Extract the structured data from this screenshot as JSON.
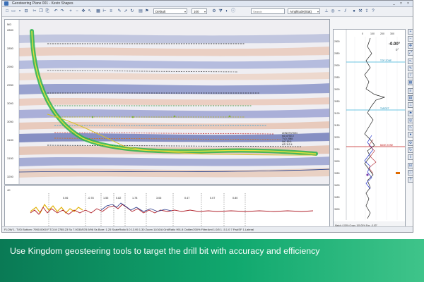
{
  "window": {
    "title": "Geosteering Plane 001 - Kevin Shapes",
    "min": "_",
    "max": "□",
    "close": "×"
  },
  "toolbar": {
    "display_select": "Default",
    "scale_select": "100",
    "attribute_select": "Amplitude(Stat)",
    "search_placeholder": "Search"
  },
  "seismic": {
    "depth_ticks": [
      "2800",
      "2850",
      "2900",
      "2950",
      "3000",
      "3050",
      "3100",
      "3150",
      "3200"
    ],
    "header_labels": [
      "MD",
      "TVD"
    ],
    "annotation_lines": [
      "ANNOTATION",
      "MD 8750.0",
      "TVD 2985",
      "INC 89.6",
      "AZI 112.4"
    ]
  },
  "bottom": {
    "segment_labels": [
      "0.06",
      "-0.78",
      "1.55",
      "0.82",
      "1.78",
      "3.06",
      "0.47",
      "0.07",
      "0.80"
    ],
    "left_tick": "40"
  },
  "log": {
    "depth_ticks": [
      "2800",
      "2850",
      "2900",
      "2950",
      "3000",
      "3050",
      "3100",
      "3150",
      "3200",
      "3250",
      "3300",
      "3350",
      "3400",
      "3450",
      "3500"
    ],
    "scale_top": [
      "0",
      "100",
      "200",
      "300"
    ],
    "value_big": "-0.00°",
    "value_small": "0°",
    "marker_labels": [
      "TOP ZONE",
      "TARGET",
      "BASE ZONE"
    ],
    "footer": "Match: 0.00%  Cross: 100.00%  Exp: -0.00°"
  },
  "status": {
    "text": "FLOW 1.  TVD Bottom: 7950.0000  F.T.D.M 2785.23 Ss  7.0030/578.9/96 Ss   Bore: 1.25  ScaleRatio 5.0   13.95  1.30 Zoom 11/16/A  GridRatio 991.8  Outlier/200%  FilterAmt 1.0/5 1 -5.1.0  7 FwdSF  1.Lateral",
    "log_footer": "7.00 1.1/88"
  },
  "banner": {
    "text": "Use Kingdom geosteering tools to target the drill bit with accuracy and efficiency"
  }
}
